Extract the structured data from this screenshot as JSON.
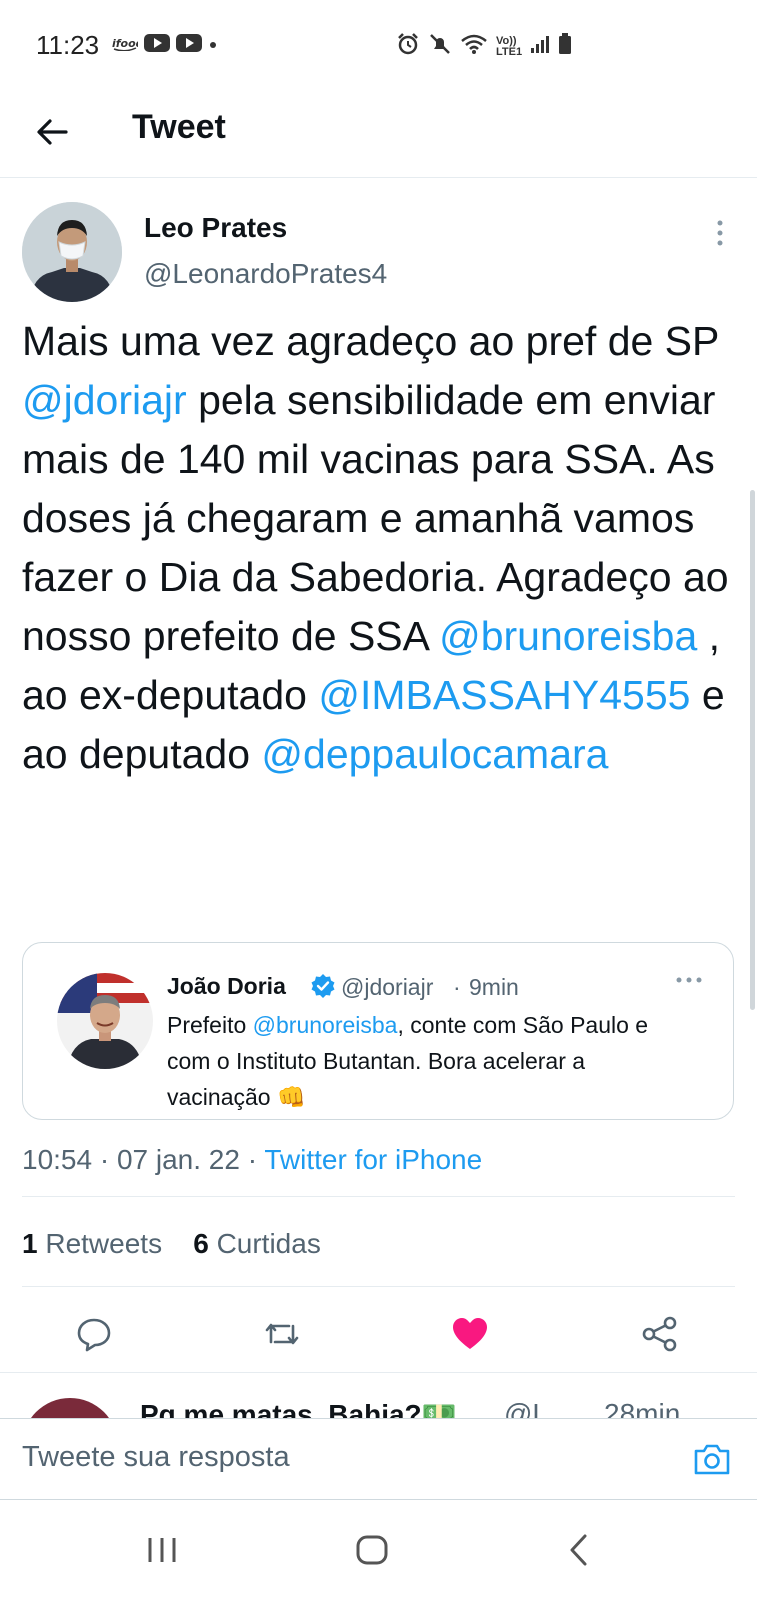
{
  "status_bar": {
    "time": "11:23",
    "left_icons": [
      "ifood-icon",
      "youtube-icon",
      "youtube-icon",
      "dot-icon"
    ],
    "right_icons": [
      "alarm-icon",
      "mute-icon",
      "wifi-icon",
      "lte-icon",
      "signal-icon",
      "battery-icon"
    ],
    "lte_label_top": "Vo))",
    "lte_label_bottom": "LTE1"
  },
  "header": {
    "title": "Tweet",
    "back_icon": "arrow-left-icon"
  },
  "tweet": {
    "author_name": "Leo Prates",
    "author_handle": "@LeonardoPrates4",
    "text_parts": [
      {
        "text": "Mais uma vez agradeço ao pref de SP ",
        "mention": false
      },
      {
        "text": "@jdoriajr",
        "mention": true
      },
      {
        "text": " pela sensibilidade em enviar mais de 140 mil vacinas para SSA. As doses já chegaram e amanhã vamos fazer o Dia da Sabedoria. Agradeço ao nosso prefeito de SSA ",
        "mention": false
      },
      {
        "text": "@brunoreisba",
        "mention": true
      },
      {
        "text": " , ao ex-deputado ",
        "mention": false
      },
      {
        "text": "@IMBASSAHY4555",
        "mention": true
      },
      {
        "text": " e ao deputado ",
        "mention": false
      },
      {
        "text": "@deppaulocamara",
        "mention": true
      }
    ],
    "quote": {
      "author_name": "João Doria",
      "author_handle": "@jdoriajr",
      "separator": "·",
      "time": "9min",
      "text_prefix": "Prefeito ",
      "text_mention": "@brunoreisba",
      "text_rest": ", conte com São Paulo e com o Instituto Butantan. Bora acelerar a vacinação 👊"
    },
    "timestamp": "10:54 · 07 jan. 22 · ",
    "source": "Twitter for iPhone",
    "retweets_count": "1",
    "retweets_label": "Retweets",
    "likes_count": "6",
    "likes_label": "Curtidas",
    "liked": true,
    "accent_color": "#1d9bf0",
    "like_color": "#f91880"
  },
  "next_tweet": {
    "author_name": "Pq me matas, Bahia?💵",
    "author_handle": "@L...",
    "time": "28min"
  },
  "reply_bar": {
    "placeholder": "Tweete sua resposta",
    "icon": "camera-icon"
  },
  "nav_bar": {
    "buttons": [
      "recent-apps-icon",
      "home-icon",
      "back-icon"
    ]
  }
}
